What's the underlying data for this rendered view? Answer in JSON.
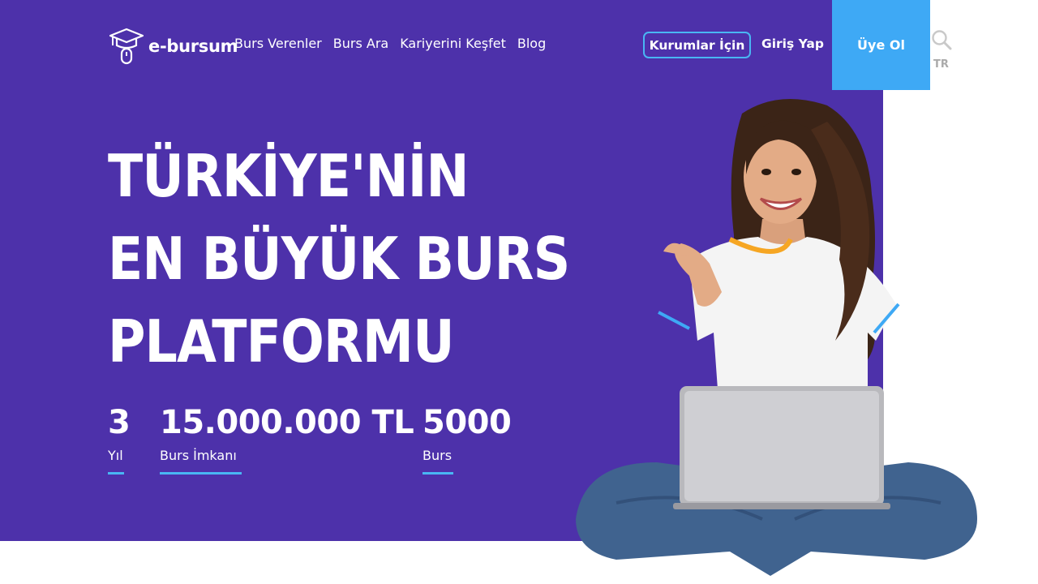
{
  "brand": {
    "logo_text": "e-bursum"
  },
  "nav": {
    "items": [
      {
        "label": "Burs Verenler"
      },
      {
        "label": "Burs Ara"
      },
      {
        "label": "Kariyerini Keşfet"
      },
      {
        "label": "Blog"
      }
    ]
  },
  "header_actions": {
    "institutions_label": "Kurumlar İçin",
    "login_label": "Giriş Yap",
    "signup_label": "Üye Ol",
    "language": "TR"
  },
  "hero": {
    "headline_lines": [
      "TÜRKİYE'NİN",
      "EN BÜYÜK BURS",
      "PLATFORMU"
    ],
    "stats": [
      {
        "value": "3",
        "label": "Yıl"
      },
      {
        "value": "15.000.000 TL",
        "label": "Burs İmkanı"
      },
      {
        "value": "5000",
        "label": "Burs"
      }
    ]
  },
  "colors": {
    "hero_background": "#4d31aa",
    "accent_blue": "#3ea9f5",
    "stat_underline": "#49b6f3"
  }
}
